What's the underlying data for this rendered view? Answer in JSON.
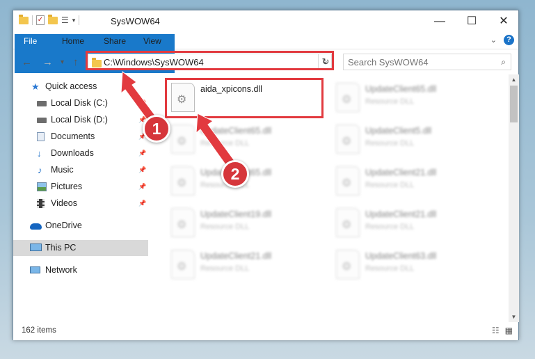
{
  "window": {
    "title": "SysWOW64"
  },
  "ribbon": {
    "tabs": [
      "File",
      "Home",
      "Share",
      "View"
    ]
  },
  "address": {
    "path": "C:\\Windows\\SysWOW64"
  },
  "search": {
    "placeholder": "Search SysWOW64"
  },
  "sidebar": {
    "items": [
      {
        "label": "Quick access"
      },
      {
        "label": "Local Disk (C:)"
      },
      {
        "label": "Local Disk (D:)"
      },
      {
        "label": "Documents"
      },
      {
        "label": "Downloads"
      },
      {
        "label": "Music"
      },
      {
        "label": "Pictures"
      },
      {
        "label": "Videos"
      },
      {
        "label": "OneDrive"
      },
      {
        "label": "This PC"
      },
      {
        "label": "Network"
      }
    ]
  },
  "files": [
    {
      "name": "aida_xpicons.dll",
      "type": ""
    },
    {
      "name": "UpdateClient65.dll",
      "type": "Resource DLL"
    },
    {
      "name": "UpdateClient65.dll",
      "type": "Resource DLL"
    },
    {
      "name": "UpdateClient5.dll",
      "type": "Resource DLL"
    },
    {
      "name": "UpdateClient65.dll",
      "type": "Resource DLL"
    },
    {
      "name": "UpdateClient21.dll",
      "type": "Resource DLL"
    },
    {
      "name": "UpdateClient19.dll",
      "type": "Resource DLL"
    },
    {
      "name": "UpdateClient21.dll",
      "type": "Resource DLL"
    },
    {
      "name": "UpdateClient21.dll",
      "type": "Resource DLL"
    },
    {
      "name": "UpdateClient63.dll",
      "type": "Resource DLL"
    }
  ],
  "status": {
    "count": "162 items"
  },
  "annotations": {
    "step1": "1",
    "step2": "2",
    "color": "#e23a3f"
  }
}
